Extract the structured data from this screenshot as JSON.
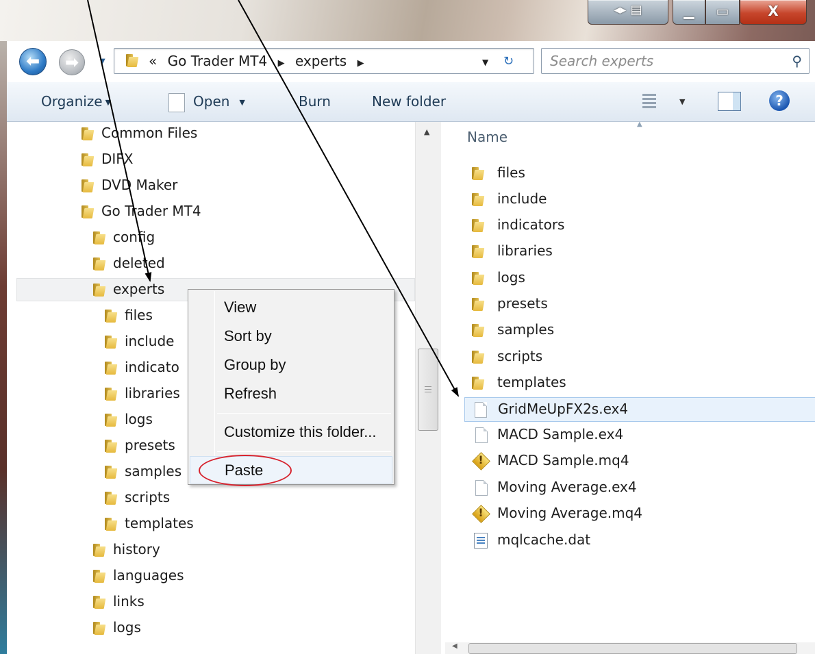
{
  "address_bar": {
    "overflow_chevron": "«",
    "breadcrumbs": [
      "Go Trader MT4",
      "experts"
    ]
  },
  "search": {
    "placeholder": "Search experts"
  },
  "toolbar": {
    "organize_label": "Organize",
    "open_label": "Open",
    "burn_label": "Burn",
    "new_folder_label": "New folder",
    "help_glyph": "?"
  },
  "nav_tree": {
    "items": [
      {
        "label": "Common Files"
      },
      {
        "label": "DIFX"
      },
      {
        "label": "DVD Maker"
      },
      {
        "label": "Go Trader MT4"
      },
      {
        "label": "config"
      },
      {
        "label": "deleted"
      },
      {
        "label": "experts",
        "selected": true
      },
      {
        "label": "files"
      },
      {
        "label": "include"
      },
      {
        "label": "indicato"
      },
      {
        "label": "libraries"
      },
      {
        "label": "logs"
      },
      {
        "label": "presets"
      },
      {
        "label": "samples"
      },
      {
        "label": "scripts"
      },
      {
        "label": "templates"
      },
      {
        "label": "history"
      },
      {
        "label": "languages"
      },
      {
        "label": "links"
      },
      {
        "label": "logs"
      }
    ]
  },
  "content": {
    "column_header": "Name",
    "items": [
      {
        "label": "files",
        "type": "folder"
      },
      {
        "label": "include",
        "type": "folder"
      },
      {
        "label": "indicators",
        "type": "folder"
      },
      {
        "label": "libraries",
        "type": "folder"
      },
      {
        "label": "logs",
        "type": "folder"
      },
      {
        "label": "presets",
        "type": "folder"
      },
      {
        "label": "samples",
        "type": "folder"
      },
      {
        "label": "scripts",
        "type": "folder"
      },
      {
        "label": "templates",
        "type": "folder"
      },
      {
        "label": "GridMeUpFX2s.ex4",
        "type": "file",
        "selected": true
      },
      {
        "label": "MACD Sample.ex4",
        "type": "file"
      },
      {
        "label": "MACD Sample.mq4",
        "type": "mq4"
      },
      {
        "label": "Moving Average.ex4",
        "type": "file"
      },
      {
        "label": "Moving Average.mq4",
        "type": "mq4"
      },
      {
        "label": "mqlcache.dat",
        "type": "dat"
      }
    ]
  },
  "context_menu": {
    "items": [
      "View",
      "Sort by",
      "Group by",
      "Refresh",
      "Customize this folder...",
      "Paste"
    ]
  },
  "annotation": {
    "circle_color": "#d7232e",
    "arrow_color": "#000000"
  },
  "colors": {
    "selection_bg": "#e8f2fc",
    "selection_border": "#a8c9ec",
    "close_button": "#c7462c"
  }
}
